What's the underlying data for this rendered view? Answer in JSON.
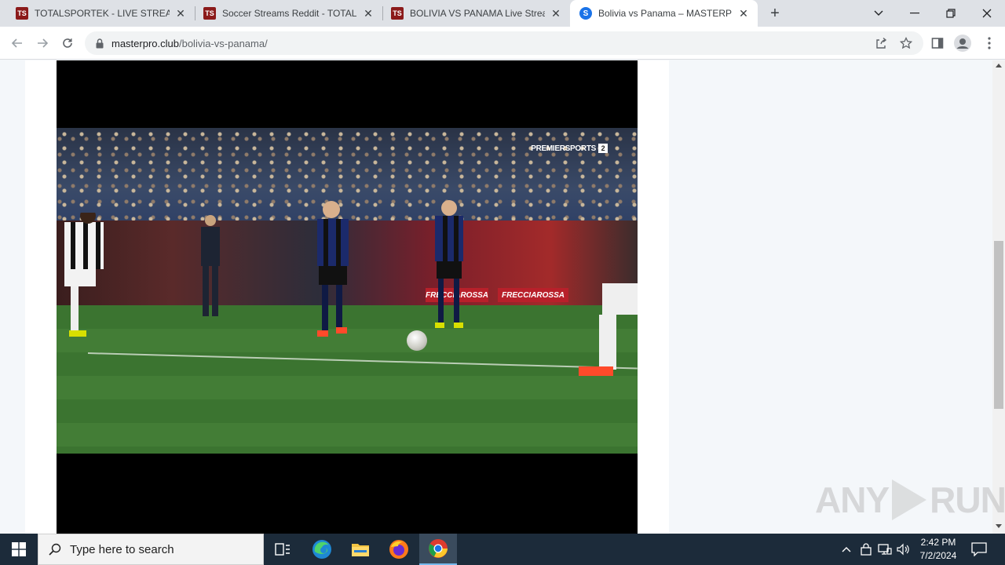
{
  "browser": {
    "tabs": [
      {
        "title": "TOTALSPORTEK - LIVE STREAMS",
        "favicon": "TS",
        "active": false
      },
      {
        "title": "Soccer Streams Reddit - TOTALSP",
        "favicon": "TS",
        "active": false
      },
      {
        "title": "BOLIVIA VS PANAMA Live Strean",
        "favicon": "TS",
        "active": false
      },
      {
        "title": "Bolivia vs Panama – MASTERPRO",
        "favicon": "S",
        "active": true
      }
    ],
    "address": {
      "domain": "masterpro.club",
      "path": "/bolivia-vs-panama/"
    }
  },
  "video": {
    "broadcaster": "PREMIERSPORTS",
    "channel": "2",
    "boards": [
      "FRECCIAROSSA",
      "FRECCIAROSSA"
    ]
  },
  "watermark": {
    "left": "ANY",
    "right": "RUN"
  },
  "taskbar": {
    "search_placeholder": "Type here to search",
    "time": "2:42 PM",
    "date": "7/2/2024"
  },
  "colors": {
    "titlebar": "#dee1e6",
    "taskbar": "#1c2b3a",
    "page_bg": "#f4f7fa",
    "ts_favicon": "#8b1a1a",
    "active_favicon": "#1a73e8"
  }
}
